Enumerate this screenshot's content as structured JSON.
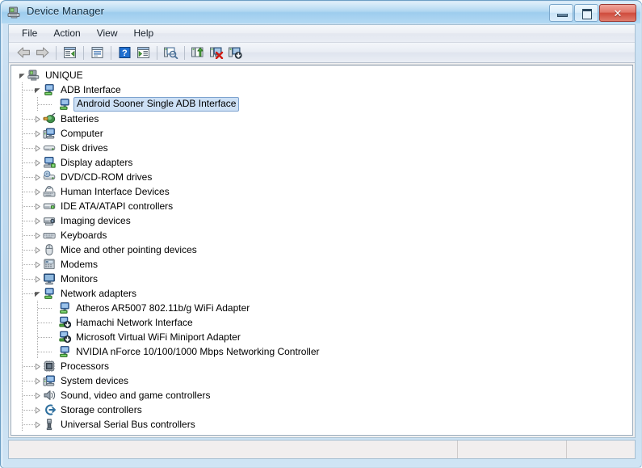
{
  "window": {
    "title": "Device Manager",
    "icon": "device-manager-icon",
    "controls": {
      "minimize": "Minimize",
      "maximize": "Maximize",
      "close": "Close",
      "close_glyph": "✕"
    },
    "accent_title_color": "#a9d3f0",
    "frame_color": "#6d9fc4",
    "close_color": "#cf4b3c"
  },
  "menubar": {
    "items": [
      {
        "label": "File",
        "name": "menu-file"
      },
      {
        "label": "Action",
        "name": "menu-action"
      },
      {
        "label": "View",
        "name": "menu-view"
      },
      {
        "label": "Help",
        "name": "menu-help"
      }
    ]
  },
  "toolbar": {
    "buttons": [
      {
        "name": "back-button",
        "icon": "back-arrow-icon",
        "tooltip": "Back"
      },
      {
        "name": "forward-button",
        "icon": "forward-arrow-icon",
        "tooltip": "Forward"
      },
      {
        "name": "show-hide-console-tree-button",
        "icon": "console-tree-icon",
        "tooltip": "Show/Hide Console Tree"
      },
      {
        "name": "properties-button",
        "icon": "properties-icon",
        "tooltip": "Properties"
      },
      {
        "name": "help-button",
        "icon": "help-question-icon",
        "tooltip": "Help"
      },
      {
        "name": "show-hide-action-pane-button",
        "icon": "action-pane-icon",
        "tooltip": "Show/Hide Action Pane"
      },
      {
        "name": "scan-for-hardware-changes-button",
        "icon": "scan-hardware-icon",
        "tooltip": "Scan for hardware changes"
      },
      {
        "name": "update-driver-button",
        "icon": "update-driver-icon",
        "tooltip": "Update Driver Software"
      },
      {
        "name": "uninstall-device-button",
        "icon": "uninstall-device-icon",
        "tooltip": "Uninstall"
      },
      {
        "name": "disable-device-button",
        "icon": "disable-device-icon",
        "tooltip": "Disable"
      }
    ]
  },
  "tree": {
    "nodes": [
      {
        "label": "UNIQUE",
        "depth": 0,
        "state": "expanded",
        "icon": "computer-node-icon",
        "selected": false
      },
      {
        "label": "ADB Interface",
        "depth": 1,
        "state": "expanded",
        "icon": "network-adapter-icon",
        "selected": false
      },
      {
        "label": "Android Sooner Single ADB Interface",
        "depth": 2,
        "state": "leaf",
        "icon": "network-adapter-icon",
        "selected": true
      },
      {
        "label": "Batteries",
        "depth": 1,
        "state": "collapsed",
        "icon": "battery-icon",
        "selected": false
      },
      {
        "label": "Computer",
        "depth": 1,
        "state": "collapsed",
        "icon": "computer-icon",
        "selected": false
      },
      {
        "label": "Disk drives",
        "depth": 1,
        "state": "collapsed",
        "icon": "disk-drive-icon",
        "selected": false
      },
      {
        "label": "Display adapters",
        "depth": 1,
        "state": "collapsed",
        "icon": "display-adapter-icon",
        "selected": false
      },
      {
        "label": "DVD/CD-ROM drives",
        "depth": 1,
        "state": "collapsed",
        "icon": "dvd-drive-icon",
        "selected": false
      },
      {
        "label": "Human Interface Devices",
        "depth": 1,
        "state": "collapsed",
        "icon": "hid-icon",
        "selected": false
      },
      {
        "label": "IDE ATA/ATAPI controllers",
        "depth": 1,
        "state": "collapsed",
        "icon": "ide-controller-icon",
        "selected": false
      },
      {
        "label": "Imaging devices",
        "depth": 1,
        "state": "collapsed",
        "icon": "imaging-device-icon",
        "selected": false
      },
      {
        "label": "Keyboards",
        "depth": 1,
        "state": "collapsed",
        "icon": "keyboard-icon",
        "selected": false
      },
      {
        "label": "Mice and other pointing devices",
        "depth": 1,
        "state": "collapsed",
        "icon": "mouse-icon",
        "selected": false
      },
      {
        "label": "Modems",
        "depth": 1,
        "state": "collapsed",
        "icon": "modem-icon",
        "selected": false
      },
      {
        "label": "Monitors",
        "depth": 1,
        "state": "collapsed",
        "icon": "monitor-icon",
        "selected": false
      },
      {
        "label": "Network adapters",
        "depth": 1,
        "state": "expanded",
        "icon": "network-adapter-icon",
        "selected": false
      },
      {
        "label": "Atheros AR5007 802.11b/g WiFi Adapter",
        "depth": 2,
        "state": "leaf",
        "icon": "network-adapter-icon",
        "selected": false
      },
      {
        "label": "Hamachi Network Interface",
        "depth": 2,
        "state": "leaf",
        "icon": "network-adapter-disabled-icon",
        "selected": false
      },
      {
        "label": "Microsoft Virtual WiFi Miniport Adapter",
        "depth": 2,
        "state": "leaf",
        "icon": "network-adapter-disabled-icon",
        "selected": false
      },
      {
        "label": "NVIDIA nForce 10/100/1000 Mbps Networking Controller",
        "depth": 2,
        "state": "leaf",
        "icon": "network-adapter-icon",
        "selected": false
      },
      {
        "label": "Processors",
        "depth": 1,
        "state": "collapsed",
        "icon": "processor-icon",
        "selected": false
      },
      {
        "label": "System devices",
        "depth": 1,
        "state": "collapsed",
        "icon": "system-device-icon",
        "selected": false
      },
      {
        "label": "Sound, video and game controllers",
        "depth": 1,
        "state": "collapsed",
        "icon": "sound-controller-icon",
        "selected": false
      },
      {
        "label": "Storage controllers",
        "depth": 1,
        "state": "collapsed",
        "icon": "storage-controller-icon",
        "selected": false
      },
      {
        "label": "Universal Serial Bus controllers",
        "depth": 1,
        "state": "collapsed",
        "icon": "usb-controller-icon",
        "selected": false
      }
    ],
    "selection_fill": "#cde0f5",
    "selection_border": "#7da2ce"
  },
  "statusbar": {
    "panes": [
      "",
      "",
      ""
    ]
  }
}
